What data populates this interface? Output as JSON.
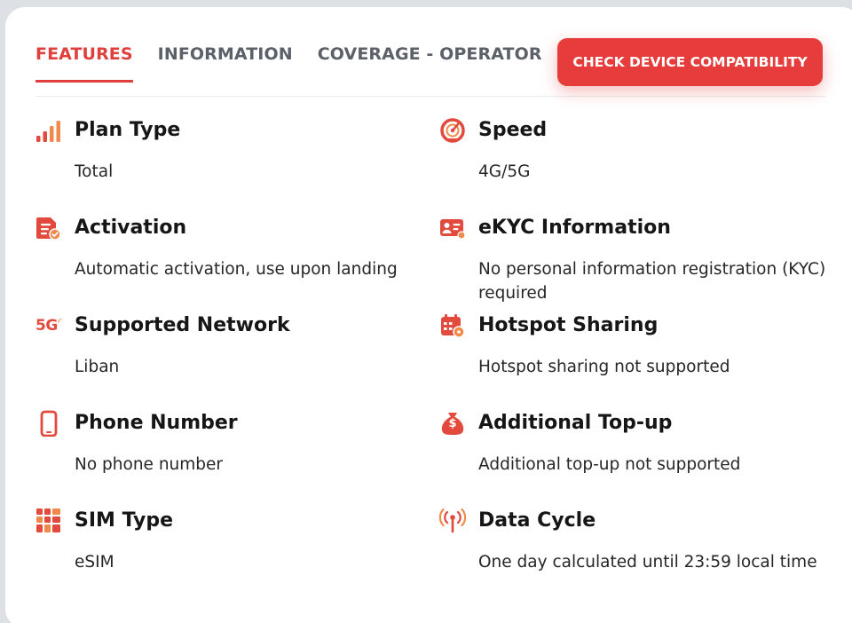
{
  "tabs": [
    {
      "label": "FEATURES",
      "active": true
    },
    {
      "label": "INFORMATION",
      "active": false
    },
    {
      "label": "COVERAGE - OPERATOR",
      "active": false
    }
  ],
  "cta_label": "CHECK DEVICE COMPATIBILITY",
  "colors": {
    "accent": "#e63c3c",
    "icon_red": "#e24a3e",
    "icon_orange": "#f08a4b",
    "tab_inactive": "#5b6069"
  },
  "features": [
    {
      "icon": "signal-bars-icon",
      "title": "Plan Type",
      "value": "Total"
    },
    {
      "icon": "speedometer-icon",
      "title": "Speed",
      "value": "4G/5G"
    },
    {
      "icon": "document-check-icon",
      "title": "Activation",
      "value": "Automatic activation, use upon landing"
    },
    {
      "icon": "id-card-icon",
      "title": "eKYC Information",
      "value": "No personal information registration (KYC) required"
    },
    {
      "icon": "5g-network-icon",
      "title": "Supported Network",
      "value": "Liban",
      "icon_text": "5G"
    },
    {
      "icon": "calendar-hotspot-icon",
      "title": "Hotspot Sharing",
      "value": "Hotspot sharing not supported"
    },
    {
      "icon": "smartphone-icon",
      "title": "Phone Number",
      "value": "No phone number"
    },
    {
      "icon": "money-bag-icon",
      "title": "Additional Top-up",
      "value": "Additional top-up not supported",
      "icon_text": "$"
    },
    {
      "icon": "sim-card-icon",
      "title": "SIM Type",
      "value": "eSIM"
    },
    {
      "icon": "broadcast-antenna-icon",
      "title": "Data Cycle",
      "value": "One day calculated until 23:59 local time"
    }
  ]
}
